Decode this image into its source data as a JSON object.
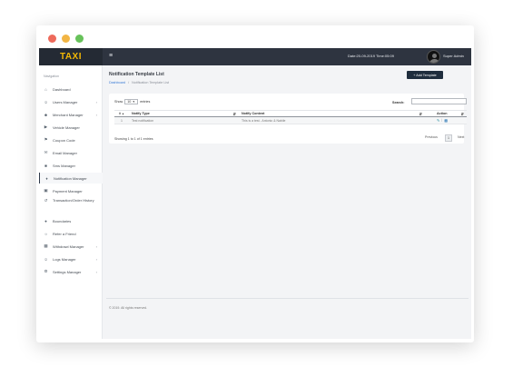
{
  "window": {
    "dot_colors": [
      "#ee6a5b",
      "#f2b544",
      "#67c25a"
    ]
  },
  "topbar": {
    "logo": "TAXI",
    "menu_icon": "hamburger-icon",
    "datetime": "Date:20-09-2019 Time:05:09",
    "username": "Super Admin"
  },
  "sidebar": {
    "heading": "Navigation",
    "items": [
      {
        "label": "Dashboard",
        "icon": "home-icon",
        "has_arrow": false
      },
      {
        "label": "Users Manager",
        "icon": "user-icon",
        "has_arrow": true
      },
      {
        "label": "Merchant Manager",
        "icon": "merchant-icon",
        "has_arrow": true
      },
      {
        "label": "Vehicle Manager",
        "icon": "vehicle-icon",
        "has_arrow": false
      },
      {
        "label": "Coupon Code",
        "icon": "tag-icon",
        "has_arrow": false
      },
      {
        "label": "Email Manager",
        "icon": "email-icon",
        "has_arrow": false
      },
      {
        "label": "Sms Manager",
        "icon": "sms-icon",
        "has_arrow": false
      },
      {
        "label": "Notification Manager",
        "icon": "bell-icon",
        "has_arrow": false,
        "active": true
      },
      {
        "label": "Payment Manager",
        "icon": "payment-icon",
        "has_arrow": false
      },
      {
        "label": "Transaction/Order History",
        "icon": "history-icon",
        "has_arrow": false
      },
      {
        "label": "Boundaries",
        "icon": "map-pin-icon",
        "has_arrow": false
      },
      {
        "label": "Refer a Friend",
        "icon": "handshake-icon",
        "has_arrow": false
      },
      {
        "label": "Withdrawl Manager",
        "icon": "wallet-icon",
        "has_arrow": true
      },
      {
        "label": "Logs Manager",
        "icon": "logs-icon",
        "has_arrow": true
      },
      {
        "label": "Settings Manager",
        "icon": "gear-icon",
        "has_arrow": true
      }
    ]
  },
  "page": {
    "title": "Notification Template List",
    "breadcrumb_link": "Dashboard",
    "breadcrumb_sep": "/",
    "breadcrumb_current": "Notification Template List",
    "add_button": "+ Add Template"
  },
  "table_controls": {
    "show_label": "Show",
    "entries_value": "10",
    "entries_label": "entries",
    "search_label": "Search:",
    "search_value": ""
  },
  "table": {
    "headers": [
      "#",
      "Notify Type",
      "Notify Content",
      "Action"
    ],
    "rows": [
      {
        "num": "1",
        "type": "Test notification",
        "content": "This is a test.. Antonio & Nabile"
      }
    ]
  },
  "pagination": {
    "info": "Showing 1 to 1 of 1 entries",
    "previous": "Previous",
    "current": "1",
    "next": "Next"
  },
  "footer": {
    "text": "© 2019. All rights reserved."
  }
}
